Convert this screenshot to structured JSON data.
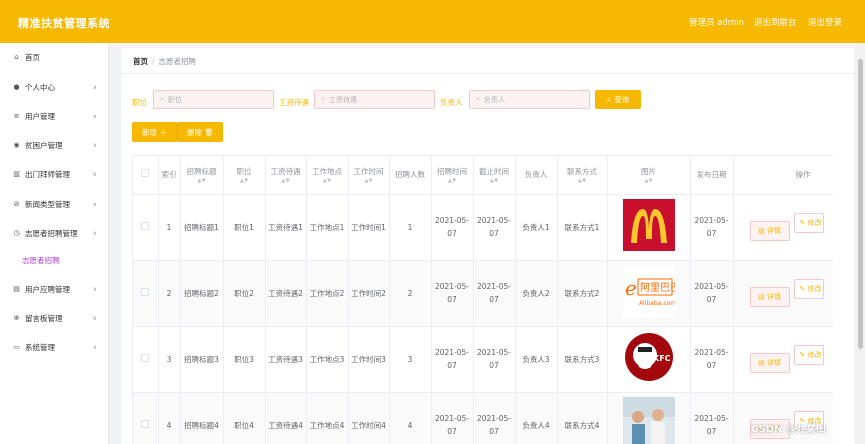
{
  "header": {
    "title": "精准扶贫管理系统",
    "user": "管理员 admin",
    "link_front": "退出到前台",
    "link_logout": "退出登录"
  },
  "sidebar": {
    "items": [
      {
        "label": "首页",
        "icon": "home-icon"
      },
      {
        "label": "个人中心",
        "icon": "user-icon"
      },
      {
        "label": "用户管理",
        "icon": "list-icon"
      },
      {
        "label": "贫困户管理",
        "icon": "location-icon"
      },
      {
        "label": "出门拜师管理",
        "icon": "chart-icon"
      },
      {
        "label": "新闻类型管理",
        "icon": "compass-icon"
      },
      {
        "label": "志愿者招聘管理",
        "icon": "clock-icon"
      },
      {
        "label": "志愿者招聘",
        "icon": ""
      },
      {
        "label": "用户应聘管理",
        "icon": "folder-icon"
      },
      {
        "label": "留言板管理",
        "icon": "globe-icon"
      },
      {
        "label": "系统管理",
        "icon": "chat-icon"
      }
    ]
  },
  "breadcrumb": {
    "home": "首页",
    "separator": "/",
    "current": "志愿者招聘"
  },
  "filters": {
    "position_label": "职位",
    "position_placeholder": "职位",
    "salary_label": "工资待遇",
    "salary_placeholder": "工资待遇",
    "manager_label": "负责人",
    "manager_placeholder": "负责人",
    "search_button": "查询"
  },
  "actions": {
    "add": "新增 ＋",
    "delete": "删除 🗑"
  },
  "table": {
    "headers": [
      "索引",
      "招聘标题",
      "职位",
      "工资待遇",
      "工作地点",
      "工作时间",
      "招聘人数",
      "招聘时间",
      "截止时间",
      "负责人",
      "联系方式",
      "图片",
      "发布日期",
      "操作"
    ],
    "detail_label": "详情",
    "edit_label": "修改",
    "rows": [
      {
        "idx": "1",
        "title": "招聘标题1",
        "position": "职位1",
        "salary": "工资待遇1",
        "place": "工作地点1",
        "time": "工作时间1",
        "count": "1",
        "start": "2021-05-07",
        "end": "2021-05-07",
        "manager": "负责人1",
        "contact": "联系方式1",
        "image": "mcdonalds-logo",
        "date": "2021-05-07"
      },
      {
        "idx": "2",
        "title": "招聘标题2",
        "position": "职位2",
        "salary": "工资待遇2",
        "place": "工作地点2",
        "time": "工作时间2",
        "count": "2",
        "start": "2021-05-07",
        "end": "2021-05-07",
        "manager": "负责人2",
        "contact": "联系方式2",
        "image": "alibaba-logo",
        "date": "2021-05-07"
      },
      {
        "idx": "3",
        "title": "招聘标题3",
        "position": "职位3",
        "salary": "工资待遇3",
        "place": "工作地点3",
        "time": "工作时间3",
        "count": "3",
        "start": "2021-05-07",
        "end": "2021-05-07",
        "manager": "负责人3",
        "contact": "联系方式3",
        "image": "kfc-logo",
        "date": "2021-05-07"
      },
      {
        "idx": "4",
        "title": "招聘标题4",
        "position": "职位4",
        "salary": "工资待遇4",
        "place": "工作地点4",
        "time": "工作时间4",
        "count": "4",
        "start": "2021-05-07",
        "end": "2021-05-07",
        "manager": "负责人4",
        "contact": "联系方式4",
        "image": "office-photo",
        "date": "2021-05-07"
      }
    ]
  },
  "watermark": "CSDN @九棠山",
  "colors": {
    "accent": "#f7b801",
    "sub_active": "#b043d1"
  }
}
